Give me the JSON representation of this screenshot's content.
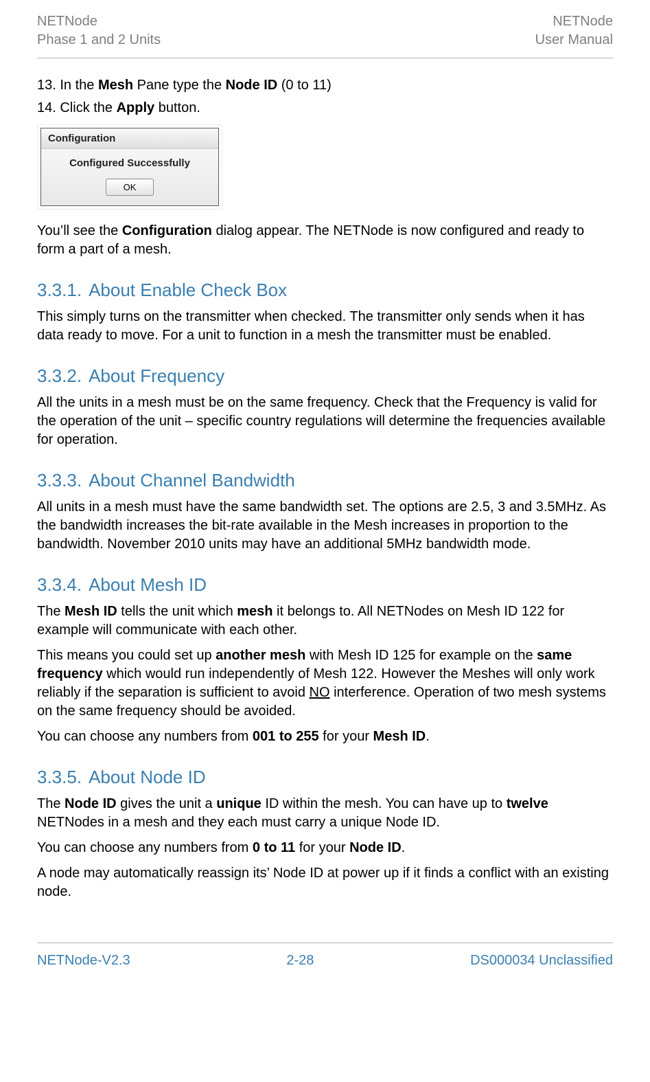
{
  "header": {
    "left1": "NETNode",
    "left2": "Phase 1 and 2 Units",
    "right1": "NETNode",
    "right2": "User Manual"
  },
  "intro": {
    "step13_a": "13. In the ",
    "step13_b": "Mesh",
    "step13_c": " Pane type the ",
    "step13_d": "Node ID",
    "step13_e": " (0 to 11)",
    "step14_a": "14. Click the ",
    "step14_b": "Apply",
    "step14_c": " button."
  },
  "dialog": {
    "title": "Configuration",
    "message": "Configured Successfully",
    "ok": "OK"
  },
  "after_dialog": {
    "a": "You’ll see the ",
    "b": "Configuration",
    "c": " dialog appear. The NETNode is now configured and ready to form a part of a mesh."
  },
  "s331": {
    "num": "3.3.1.",
    "title": "About Enable Check Box",
    "p1": "This simply turns on the transmitter when checked. The transmitter only sends when it has data ready to move. For a unit to function in a mesh the transmitter must be enabled."
  },
  "s332": {
    "num": "3.3.2.",
    "title": "About Frequency",
    "p1": "All the units in a mesh must be on the same frequency. Check that the Frequency is valid for the operation of the unit – specific country regulations will determine the frequencies available for operation."
  },
  "s333": {
    "num": "3.3.3.",
    "title": "About Channel Bandwidth",
    "p1": "All units in a mesh must have the same bandwidth set. The options are 2.5, 3 and 3.5MHz. As the bandwidth increases the bit-rate available in the Mesh increases in proportion to the bandwidth. November 2010 units may have an additional 5MHz bandwidth mode."
  },
  "s334": {
    "num": "3.3.4.",
    "title": "About Mesh ID",
    "p1_a": "The ",
    "p1_b": "Mesh ID",
    "p1_c": " tells the unit which ",
    "p1_d": "mesh",
    "p1_e": " it belongs to. All NETNodes on Mesh ID 122 for example will communicate with each other.",
    "p2_a": "This means you could set up ",
    "p2_b": "another mesh",
    "p2_c": " with Mesh ID 125 for example on the ",
    "p2_d": "same frequency",
    "p2_e": " which would run independently of Mesh 122. However the Meshes will only work reliably if the separation is sufficient to avoid ",
    "p2_f": "NO",
    "p2_g": " interference. Operation of two mesh systems on the same frequency should be avoided.",
    "p3_a": "You can choose any numbers from ",
    "p3_b": "001 to 255",
    "p3_c": " for your ",
    "p3_d": "Mesh ID",
    "p3_e": "."
  },
  "s335": {
    "num": "3.3.5.",
    "title": "About Node ID",
    "p1_a": "The ",
    "p1_b": "Node ID",
    "p1_c": " gives the unit a ",
    "p1_d": "unique",
    "p1_e": " ID within the mesh. You can have up to ",
    "p1_f": "twelve",
    "p1_g": " NETNodes in a mesh and they each must carry a unique Node ID.",
    "p2_a": "You can choose any numbers from ",
    "p2_b": "0 to 11",
    "p2_c": " for your ",
    "p2_d": "Node ID",
    "p2_e": ".",
    "p3": "A node may automatically reassign its’ Node ID at power up if it finds a conflict with an existing node."
  },
  "footer": {
    "left": "NETNode-V2.3",
    "center": "2-28",
    "right": "DS000034 Unclassified"
  }
}
